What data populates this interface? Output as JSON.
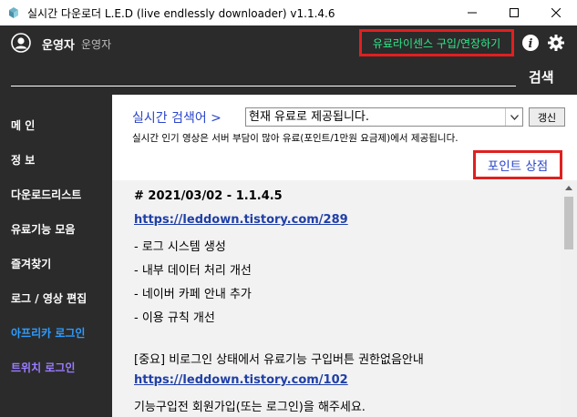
{
  "window": {
    "title": "실시간 다운로더 L.E.D (live endlessly downloader) v1.1.4.6",
    "icon": "app-icon",
    "controls": [
      "minimize-icon",
      "maximize-icon",
      "close-icon"
    ]
  },
  "header": {
    "user_name": "운영자",
    "user_sub": "운영자",
    "license_button": "유료라이센스 구입/연장하기",
    "search_placeholder": "",
    "search_button": "검색",
    "accent_license": "#2ee88a",
    "highlight_border": "#e02020"
  },
  "sidebar": {
    "items": [
      {
        "label": "메 인",
        "color": "#ffffff"
      },
      {
        "label": "정 보",
        "color": "#ffffff"
      },
      {
        "label": "다운로드리스트",
        "color": "#ffffff"
      },
      {
        "label": "유료기능 모음",
        "color": "#ffffff"
      },
      {
        "label": "즐겨찾기",
        "color": "#ffffff"
      },
      {
        "label": "로그 / 영상 편집",
        "color": "#ffffff"
      },
      {
        "label": "아프리카 로그인",
        "color": "#2e9cff"
      },
      {
        "label": "트위치 로그인",
        "color": "#9b7cff"
      }
    ]
  },
  "main": {
    "breadcrumb": "실시간 검색어 >",
    "select_value": "현재 유료로 제공됩니다.",
    "refresh_button": "갱신",
    "notice": "실시간 인기 영상은 서버 부담이 많아 유료(포인트/1만원 요금제)에서 제공됩니다.",
    "shop_link": "포인트 상점",
    "changelog": [
      {
        "text": "# 2021/03/02 - 1.1.4.5",
        "style": "bold"
      },
      {
        "text": "https://leddown.tistory.com/289",
        "style": "link"
      },
      {
        "text": "- 로그 시스템 생성",
        "style": "plain"
      },
      {
        "text": "- 내부 데이터 처리 개선",
        "style": "plain"
      },
      {
        "text": "- 네이버 카페 안내 추가",
        "style": "plain"
      },
      {
        "text": "- 이용 규칙 개선",
        "style": "plain"
      },
      {
        "text": "",
        "style": "plain"
      },
      {
        "text": "[중요] 비로그인 상태에서 유료기능 구입버튼 권한없음안내",
        "style": "plain"
      },
      {
        "text": "https://leddown.tistory.com/102",
        "style": "link"
      },
      {
        "text": "기능구입전 회원가입(또는 로그인)을 해주세요.",
        "style": "plain"
      }
    ]
  }
}
